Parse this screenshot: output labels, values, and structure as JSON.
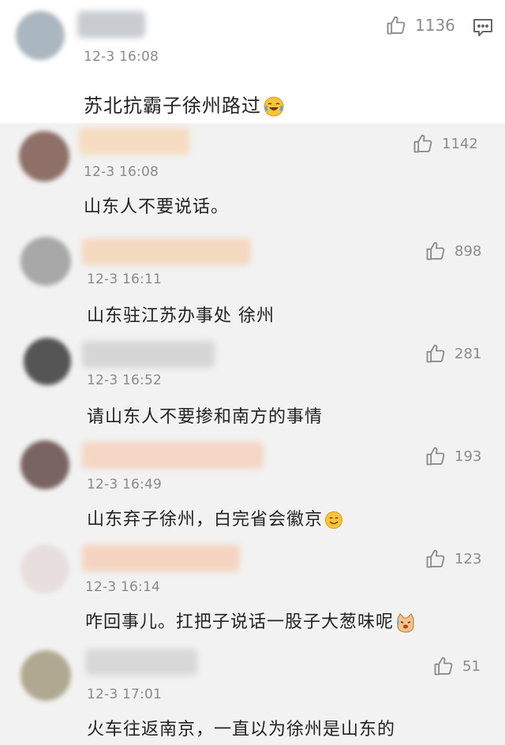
{
  "comments": [
    {
      "time": "12-3 16:08",
      "likes": "1136",
      "text": "苏北抗霸子徐州路过",
      "emoji": "laugh-cry"
    },
    {
      "time": "12-3 16:08",
      "likes": "1142",
      "text": "山东人不要说话。"
    },
    {
      "time": "12-3 16:11",
      "likes": "898",
      "text": "山东驻江苏办事处 徐州"
    },
    {
      "time": "12-3 16:52",
      "likes": "281",
      "text": "请山东人不要掺和南方的事情"
    },
    {
      "time": "12-3 16:49",
      "likes": "193",
      "text": "山东弃子徐州，白完省会徽京",
      "emoji": "smile"
    },
    {
      "time": "12-3 16:14",
      "likes": "123",
      "text": "咋回事儿。扛把子说话一股子大葱味呢",
      "emoji": "cat"
    },
    {
      "time": "12-3 17:01",
      "likes": "51",
      "text": "火车往返南京，一直以为徐州是山东的"
    }
  ],
  "colors": {
    "avatar_1": "#aab6c0",
    "avatar_2": "#8e7068",
    "avatar_3": "#a8a8a8",
    "avatar_4": "#555555",
    "avatar_5": "#7a6462",
    "avatar_6": "#e8dede",
    "avatar_7": "#b0a890",
    "username_1": "#c8ccd0",
    "username_2": "#f6dcc0",
    "username_3": "#f4d8c0",
    "username_4": "#d6d6d6",
    "username_5": "#f4d6c4",
    "username_6": "#f4d4c0",
    "username_7": "#d8d8d8"
  }
}
